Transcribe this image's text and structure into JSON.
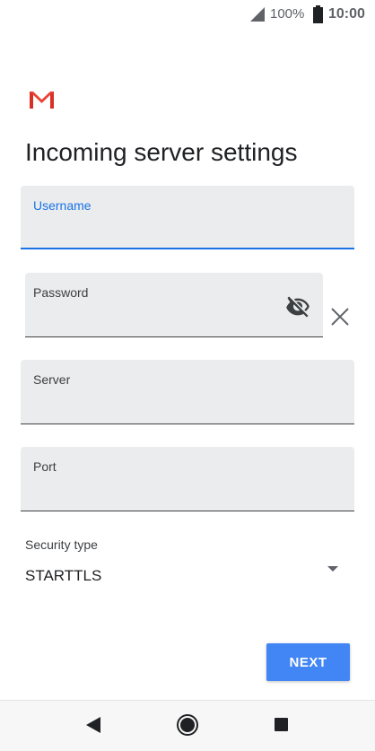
{
  "status_bar": {
    "battery_percent": "100%",
    "time": "10:00",
    "icons": [
      "signal-icon",
      "battery-icon"
    ]
  },
  "logo": "gmail-logo",
  "page": {
    "title": "Incoming server settings"
  },
  "fields": {
    "username": {
      "label": "Username",
      "value": ""
    },
    "password": {
      "label": "Password",
      "value": ""
    },
    "server": {
      "label": "Server",
      "value": ""
    },
    "port": {
      "label": "Port",
      "value": ""
    }
  },
  "security": {
    "label": "Security type",
    "selected": "STARTTLS"
  },
  "actions": {
    "next_label": "NEXT"
  },
  "colors": {
    "accent": "#1a73e8",
    "button": "#4285f4",
    "field_bg": "#ebeced"
  }
}
